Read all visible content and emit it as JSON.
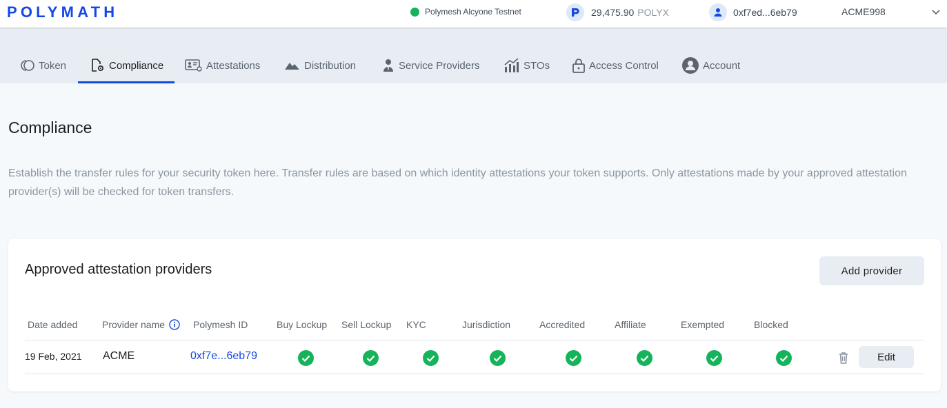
{
  "header": {
    "logo": "POLYMATH",
    "network": "Polymesh Alcyone Testnet",
    "balance_amount": "29,475.90",
    "balance_unit": "POLYX",
    "account_address": "0xf7ed...6eb79",
    "username": "ACME998",
    "colors": {
      "brand": "#1348e4",
      "online": "#15b35a"
    }
  },
  "tabs": [
    {
      "label": "Token",
      "icon": "token-icon"
    },
    {
      "label": "Compliance",
      "icon": "compliance-doc-gear-icon",
      "active": true
    },
    {
      "label": "Attestations",
      "icon": "id-card-gear-icon"
    },
    {
      "label": "Distribution",
      "icon": "mountain-icon"
    },
    {
      "label": "Service Providers",
      "icon": "person-tie-icon"
    },
    {
      "label": "STOs",
      "icon": "chart-bars-icon"
    },
    {
      "label": "Access Control",
      "icon": "lock-icon"
    },
    {
      "label": "Account",
      "icon": "user-circle-icon"
    }
  ],
  "page": {
    "title": "Compliance",
    "description": "Establish the transfer rules for your security token here. Transfer rules are based on which identity attestations your token supports. Only attestations made by your approved attestation provider(s) will be checked for token transfers."
  },
  "providers_card": {
    "title": "Approved attestation providers",
    "add_button": "Add provider",
    "columns": [
      "Date added",
      "Provider name",
      "Polymesh ID",
      "Buy Lockup",
      "Sell Lockup",
      "KYC",
      "Jurisdiction",
      "Accredited",
      "Affiliate",
      "Exempted",
      "Blocked"
    ],
    "rows": [
      {
        "date_added": "19 Feb, 2021",
        "provider_name": "ACME",
        "polymesh_id": "0xf7e...6eb79",
        "checks": [
          true,
          true,
          true,
          true,
          true,
          true,
          true,
          true
        ],
        "edit_label": "Edit"
      }
    ]
  }
}
